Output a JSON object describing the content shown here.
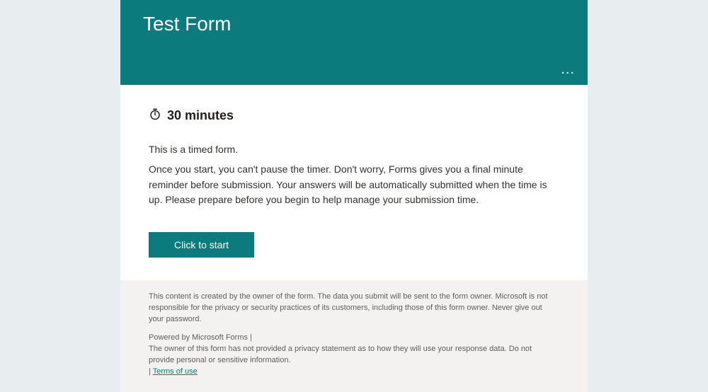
{
  "header": {
    "title": "Test Form",
    "more_label": "..."
  },
  "timer": {
    "icon": "stopwatch-icon",
    "duration_label": "30 minutes"
  },
  "intro_line": "This is a timed form.",
  "body_text": "Once you start, you can't pause the timer. Don't worry, Forms gives you a final minute reminder before submission. Your answers will be automatically submitted when the time is up. Please prepare before you begin to help manage your submission time.",
  "actions": {
    "start_label": "Click to start"
  },
  "footer": {
    "disclaimer": "This content is created by the owner of the form. The data you submit will be sent to the form owner. Microsoft is not responsible for the privacy or security practices of its customers, including those of this form owner. Never give out your password.",
    "powered_by": "Powered by Microsoft Forms",
    "privacy_note": "The owner of this form has not provided a privacy statement as to how they will use your response data. Do not provide personal or sensitive information.",
    "terms_link": "Terms of use"
  },
  "colors": {
    "accent": "#0b7b7e",
    "page_bg": "#e8eef0",
    "footer_bg": "#f3f2f1"
  }
}
